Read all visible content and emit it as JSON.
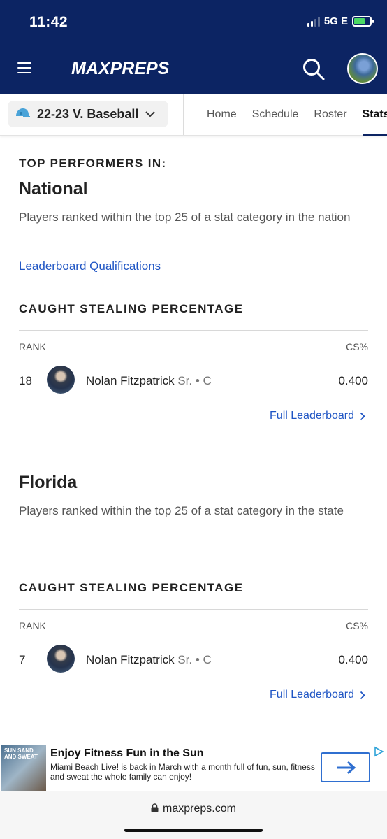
{
  "status_bar": {
    "time": "11:42",
    "network": "5G E"
  },
  "header": {
    "logo_text": "MAXPREPS"
  },
  "team_bar": {
    "team_name": "22-23 V. Baseball",
    "tabs": [
      {
        "label": "Home"
      },
      {
        "label": "Schedule"
      },
      {
        "label": "Roster"
      },
      {
        "label": "Stats"
      }
    ],
    "active_tab": "Stats"
  },
  "national": {
    "kicker": "TOP PERFORMERS IN:",
    "heading": "National",
    "description": "Players ranked within the top 25 of a stat category in the nation",
    "qualifications_link": "Leaderboard Qualifications",
    "category": {
      "title": "CAUGHT STEALING PERCENTAGE",
      "rank_header": "RANK",
      "stat_header": "CS%",
      "rows": [
        {
          "rank": "18",
          "name": "Nolan Fitzpatrick",
          "meta": "Sr. • C",
          "value": "0.400"
        }
      ],
      "full_leaderboard": "Full Leaderboard"
    }
  },
  "state": {
    "heading": "Florida",
    "description": "Players ranked within the top 25 of a stat category in the state",
    "category": {
      "title": "CAUGHT STEALING PERCENTAGE",
      "rank_header": "RANK",
      "stat_header": "CS%",
      "rows": [
        {
          "rank": "7",
          "name": "Nolan Fitzpatrick",
          "meta": "Sr. • C",
          "value": "0.400"
        }
      ],
      "full_leaderboard": "Full Leaderboard"
    }
  },
  "ad": {
    "thumb_text": "SUN SAND AND SWEAT",
    "title": "Enjoy Fitness Fun in the Sun",
    "body": "Miami Beach Live! is back in March with a month full of fun, sun, fitness and sweat the whole family can enjoy!"
  },
  "browser": {
    "url": "maxpreps.com"
  },
  "colors": {
    "header_bg": "#0c2463",
    "link": "#1f55c4",
    "accent_arrow": "#2f6fd0"
  }
}
